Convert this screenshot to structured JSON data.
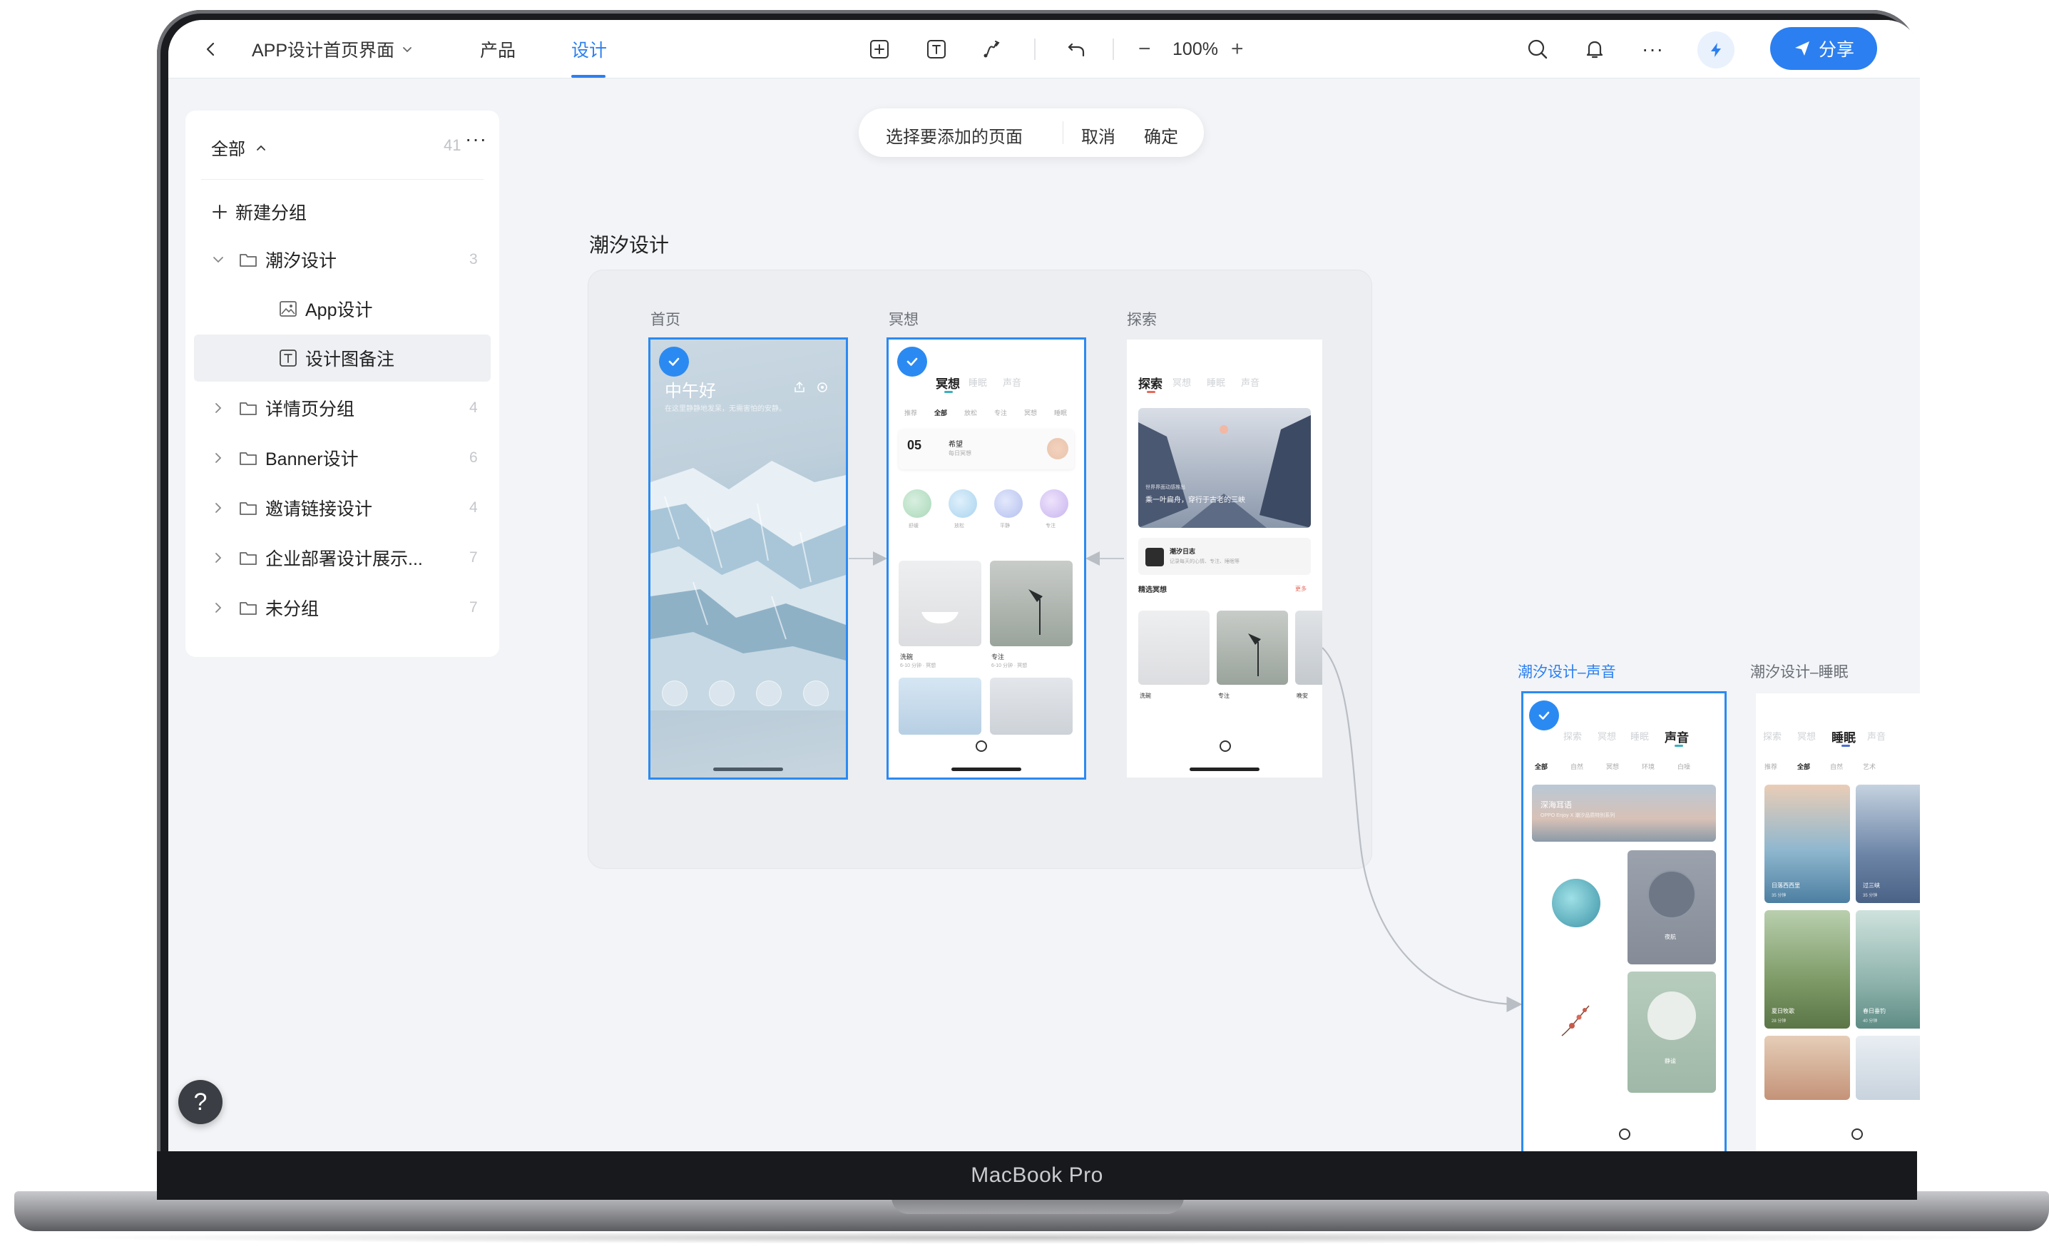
{
  "device_label": "MacBook Pro",
  "topbar": {
    "doc_title": "APP设计首页界面",
    "tabs": [
      {
        "label": "产品"
      },
      {
        "label": "设计"
      }
    ],
    "active_tab": "设计",
    "zoom": "100%",
    "zoom_out": "−",
    "zoom_in": "+",
    "more": "···",
    "share_label": "分享",
    "accent": "#2b7ff0"
  },
  "sidebar": {
    "filter_label": "全部",
    "total": "41",
    "more": "···",
    "new_group": "新建分组",
    "items": [
      {
        "label": "潮汐设计",
        "count": "3",
        "icon": "folder-icon",
        "expanded": true
      },
      {
        "label": "App设计",
        "icon": "image-icon",
        "child": true
      },
      {
        "label": "设计图备注",
        "icon": "text-box-icon",
        "child": true,
        "active": true
      },
      {
        "label": "详情页分组",
        "count": "4",
        "icon": "folder-icon"
      },
      {
        "label": "Banner设计",
        "count": "6",
        "icon": "folder-icon"
      },
      {
        "label": "邀请链接设计",
        "count": "4",
        "icon": "folder-icon"
      },
      {
        "label": "企业部署设计展示...",
        "count": "7",
        "icon": "folder-icon"
      },
      {
        "label": "未分组",
        "count": "7",
        "icon": "folder-icon"
      }
    ]
  },
  "canvas": {
    "pill": {
      "prompt": "选择要添加的页面",
      "cancel": "取消",
      "confirm": "确定"
    },
    "group_title": "潮汐设计",
    "frames": [
      {
        "label": "首页",
        "selected": true
      },
      {
        "label": "冥想",
        "selected": true
      },
      {
        "label": "探索",
        "selected": false
      },
      {
        "label": "潮汐设计–声音",
        "selected": true
      },
      {
        "label": "潮汐设计–睡眠",
        "selected": false
      }
    ]
  },
  "screens": {
    "home": {
      "greeting": "中午好",
      "sub": "在这里静静地发呆，无需害怕的安静。"
    },
    "meditate": {
      "title": "冥想",
      "faint_tabs": [
        "睡眠",
        "声音"
      ],
      "cats": [
        "推荐",
        "全部",
        "放松",
        "专注",
        "冥想",
        "睡眠"
      ],
      "day": "05",
      "card_title": "希望",
      "card_sub": "每日冥想",
      "circle_labels": [
        "舒缓",
        "放松",
        "平静",
        "专注"
      ],
      "tile_labels": [
        "洗碗",
        "专注"
      ],
      "tile_subs": [
        "6-10 分钟 · 冥想",
        "6-10 分钟 · 冥想"
      ]
    },
    "explore": {
      "title": "探索",
      "faint_tabs": [
        "冥想",
        "睡眠",
        "声音"
      ],
      "banner_small": "世界界面动感推出",
      "banner_text": "乘一叶扁舟，穿行于古老的三峡",
      "journal_title": "潮汐日志",
      "journal_sub": "记录每天的心情、专注、睡眠等",
      "section": "精选冥想",
      "section_more": "更多",
      "tile_labels": [
        "洗碗",
        "专注",
        "晚安"
      ]
    },
    "sound": {
      "title": "声音",
      "faint_tabs": [
        "探索",
        "冥想",
        "睡眠"
      ],
      "cats": [
        "全部",
        "自然",
        "冥想",
        "环境",
        "白噪"
      ],
      "banner": "深海耳语",
      "banner_sub": "OPPO Enjoy X 潮汐品质特别系列",
      "tile_labels": [
        "夜航",
        "静谧"
      ]
    },
    "sleep": {
      "title": "睡眠",
      "faint_tabs": [
        "探索",
        "冥想",
        "声音"
      ],
      "cats": [
        "推荐",
        "全部",
        "自然",
        "艺术"
      ],
      "tile_labels": [
        "日落西西里",
        "过三峡",
        "夏日牧歌",
        "春日垂钓"
      ],
      "tile_subs": [
        "35 分钟",
        "35 分钟",
        "28 分钟",
        "40 分钟"
      ]
    }
  }
}
